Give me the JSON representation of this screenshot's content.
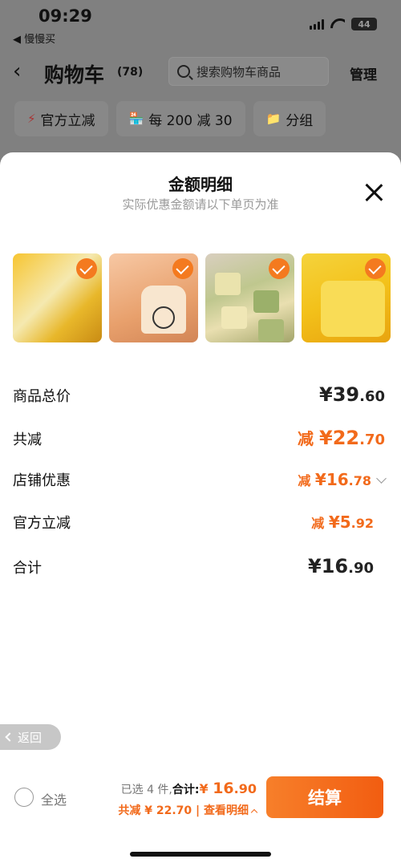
{
  "status_bar": {
    "time": "09:29",
    "back_app": "◀ 慢慢买",
    "battery": "44"
  },
  "nav": {
    "title": "购物车",
    "count": "(78)",
    "search_placeholder": "搜索购物车商品",
    "manage": "管理"
  },
  "chips": [
    {
      "icon": "⚡",
      "label": "官方立减"
    },
    {
      "icon": "🏪",
      "label": "每 200 减 30"
    },
    {
      "icon": "📁",
      "label": "分组"
    }
  ],
  "sheet": {
    "title": "金额明细",
    "subtitle": "实际优惠金额请以下单页为准",
    "rows": [
      {
        "label": "商品总价",
        "prefix": "",
        "yen": "¥",
        "int": "39",
        "dec": ".60"
      },
      {
        "label": "共减",
        "prefix": "减 ",
        "yen": "¥",
        "int": "22",
        "dec": ".70"
      },
      {
        "label": "店铺优惠",
        "prefix": "减 ",
        "yen": "¥",
        "int": "16",
        "dec": ".78"
      },
      {
        "label": "官方立减",
        "prefix": "减 ",
        "yen": "¥",
        "int": "5",
        "dec": ".92"
      },
      {
        "label": "合计",
        "prefix": "",
        "yen": "¥",
        "int": "16",
        "dec": ".90"
      }
    ]
  },
  "back_pill": "返回",
  "footer": {
    "select_all": "全选",
    "selected_text": "已选 4 件,",
    "total_label": "合计:",
    "total_yen": "¥ ",
    "total_int": "16",
    "total_dec": ".90",
    "discount_text": "共减 ¥ 22.70 | 查看明细",
    "checkout": "结算"
  },
  "colors": {
    "accent": "#f26a1b"
  }
}
